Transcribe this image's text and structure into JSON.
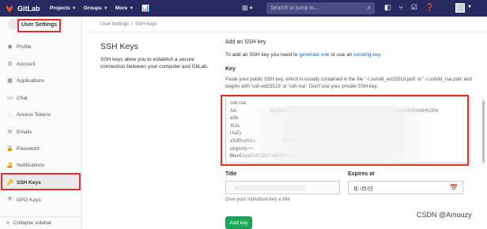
{
  "navbar": {
    "brand": "GitLab",
    "menus": [
      {
        "label": "Projects"
      },
      {
        "label": "Groups"
      },
      {
        "label": "More"
      }
    ],
    "search_placeholder": "Search or jump to...",
    "bg_color": "#292961"
  },
  "sidebar": {
    "header": "User Settings",
    "items": [
      {
        "label": "Profile",
        "icon": "profile-icon",
        "glyph": "◉"
      },
      {
        "label": "Account",
        "icon": "account-icon",
        "glyph": "⚙"
      },
      {
        "label": "Applications",
        "icon": "applications-icon",
        "glyph": "▦"
      },
      {
        "label": "Chat",
        "icon": "chat-icon",
        "glyph": "▭"
      },
      {
        "label": "Access Tokens",
        "icon": "access-tokens-icon",
        "glyph": "◌"
      },
      {
        "label": "Emails",
        "icon": "emails-icon",
        "glyph": "✉"
      },
      {
        "label": "Password",
        "icon": "password-icon",
        "glyph": "🔒"
      },
      {
        "label": "Notifications",
        "icon": "notifications-icon",
        "glyph": "🔔"
      },
      {
        "label": "SSH Keys",
        "icon": "ssh-keys-icon",
        "glyph": "🔑",
        "active": true
      },
      {
        "label": "GPG Keys",
        "icon": "gpg-keys-icon",
        "glyph": "⛨"
      }
    ],
    "collapse_label": "Collapse sidebar"
  },
  "breadcrumb": {
    "parent": "User Settings",
    "current": "SSH Keys"
  },
  "page": {
    "title": "SSH Keys",
    "description": "SSH keys allow you to establish a secure connection between your computer and GitLab."
  },
  "form": {
    "heading": "Add an SSH key",
    "intro_prefix": "To add an SSH key you need to ",
    "intro_link1": "generate one",
    "intro_mid": " or use an ",
    "intro_link2": "existing key",
    "intro_suffix": ".",
    "key_label": "Key",
    "key_help": "Paste your public SSH key, which is usually contained in the file '~/.ssh/id_ed25519.pub' or '~/.ssh/id_rsa.pub' and begins with 'ssh-ed25519' or 'ssh-rsa'. Don't use your private SSH key.",
    "key_lines": [
      "ssh-rsa",
      "AA                         1yc2EAAAADAQABAAABgQCkxtkkYhbEeCcdHm7FoSV3mJsyHW2M4dHN2Pn",
      "aSk                                                                                    ",
      "XUic                                                      nuM0UKuSPP+8lyy+Hp",
      "UuZy                                         GI/vcNQX",
      "xS3Rodfsk1                    C67WhUKdr1gX7h+ssJHO/bN/",
      "uUye8fp++                                             WpOMK9CAN              ayOLqk",
      "BlevE1ysCUCJZLFv6RR9/AUbpG                                                      WDuS"
    ],
    "title_label": "Title",
    "title_help": "Give your individual key a title",
    "expires_label": "Expires at",
    "expires_placeholder": "年 /月/日",
    "submit_label": "Add key",
    "submit_color": "#1aaa55"
  },
  "watermark": "CSDN @Amouzy",
  "highlight_color": "#e32e2e"
}
